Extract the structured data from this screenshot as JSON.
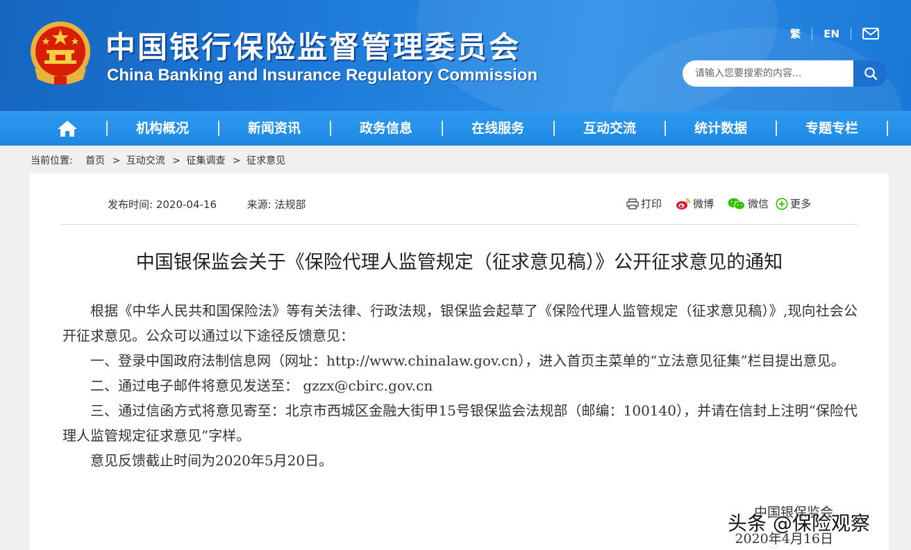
{
  "header": {
    "title_cn": "中国银行保险监督管理委员会",
    "title_en": "China Banking and Insurance Regulatory Commission",
    "lang_traditional": "繁",
    "lang_english": "EN",
    "mail_icon": "mail-icon",
    "emblem_icon": "national-emblem-icon",
    "search": {
      "placeholder": "请输入您要搜索的内容..."
    }
  },
  "nav": {
    "home_icon": "home-icon",
    "items": [
      "机构概况",
      "新闻资讯",
      "政务信息",
      "在线服务",
      "互动交流",
      "统计数据",
      "专题专栏"
    ]
  },
  "breadcrumb": {
    "prefix": "当前位置:",
    "items": [
      "首页",
      "互动交流",
      "征集调查",
      "征求意见"
    ],
    "separator": ">"
  },
  "article": {
    "publish_label": "发布时间:",
    "publish_date": "2020-04-16",
    "source_label": "来源:",
    "source": "法规部",
    "share": {
      "print": "打印",
      "weibo": "微博",
      "wechat": "微信",
      "more": "更多"
    },
    "title": "中国银保监会关于《保险代理人监管规定（征求意见稿）》公开征求意见的通知",
    "paragraphs": [
      "根据《中华人民共和国保险法》等有关法律、行政法规，银保监会起草了《保险代理人监管规定（征求意见稿）》,现向社会公开征求意见。公众可以通过以下途径反馈意见：",
      "一、登录中国政府法制信息网（网址：http://www.chinalaw.gov.cn），进入首页主菜单的“立法意见征集”栏目提出意见。",
      "二、通过电子邮件将意见发送至： gzzx@cbirc.gov.cn",
      "三、通过信函方式将意见寄至：北京市西城区金融大街甲15号银保监会法规部（邮编：100140），并请在信封上注明“保险代理人监管规定征求意见”字样。",
      "意见反馈截止时间为2020年5月20日。"
    ],
    "signoff_org": "中国银保监会",
    "signoff_date": "2020年4月16日"
  },
  "watermark": "头条 @保险观察",
  "colors": {
    "header_blue": "#1e7ad8",
    "nav_blue": "#2490e6",
    "search_button": "#1d6fd0",
    "weibo_red": "#e6162d",
    "wechat_green": "#2dc100"
  }
}
